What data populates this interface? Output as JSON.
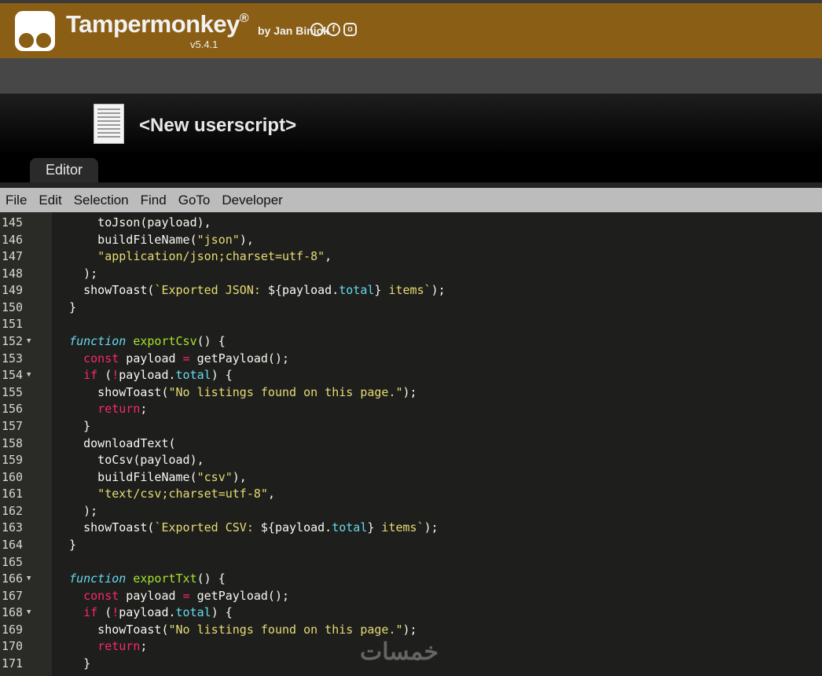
{
  "header": {
    "app_name": "Tampermonkey",
    "registered": "®",
    "byline": "by Jan Biniok",
    "version": "v5.4.1",
    "social_icons": [
      "github-icon",
      "facebook-icon",
      "instagram-icon"
    ],
    "brand_color": "#8a5e14"
  },
  "script": {
    "title": "<New userscript>"
  },
  "tabs": [
    {
      "label": "Editor",
      "active": true
    }
  ],
  "menu": [
    "File",
    "Edit",
    "Selection",
    "Find",
    "GoTo",
    "Developer"
  ],
  "editor": {
    "theme_colors": {
      "string": "#e6db74",
      "keyword": "#f92672",
      "storage": "#66d9ef",
      "function_name": "#a6e22e",
      "property": "#66d9ef",
      "plain": "#f8f8f2"
    },
    "lines": [
      {
        "n": "145",
        "t": [
          [
            "p",
            "      toJson(payload),"
          ]
        ]
      },
      {
        "n": "146",
        "t": [
          [
            "p",
            "      buildFileName("
          ],
          [
            "s",
            "\"json\""
          ],
          [
            "p",
            "),"
          ]
        ]
      },
      {
        "n": "147",
        "t": [
          [
            "p",
            "      "
          ],
          [
            "s",
            "\"application/json;charset=utf-8\""
          ],
          [
            "p",
            ","
          ]
        ]
      },
      {
        "n": "148",
        "t": [
          [
            "p",
            "    );"
          ]
        ]
      },
      {
        "n": "149",
        "t": [
          [
            "p",
            "    showToast("
          ],
          [
            "s",
            "`Exported JSON: "
          ],
          [
            "p",
            "${payload."
          ],
          [
            "c",
            "total"
          ],
          [
            "p",
            "}"
          ],
          [
            "s",
            " items`"
          ],
          [
            "p",
            ");"
          ]
        ]
      },
      {
        "n": "150",
        "t": [
          [
            "p",
            "  }"
          ]
        ]
      },
      {
        "n": "151",
        "t": []
      },
      {
        "n": "152",
        "fold": true,
        "t": [
          [
            "p",
            "  "
          ],
          [
            "f",
            "function"
          ],
          [
            "p",
            " "
          ],
          [
            "n",
            "exportCsv"
          ],
          [
            "p",
            "() {"
          ]
        ]
      },
      {
        "n": "153",
        "t": [
          [
            "p",
            "    "
          ],
          [
            "k",
            "const"
          ],
          [
            "p",
            " payload "
          ],
          [
            "k",
            "="
          ],
          [
            "p",
            " getPayload();"
          ]
        ]
      },
      {
        "n": "154",
        "fold": true,
        "t": [
          [
            "p",
            "    "
          ],
          [
            "k",
            "if"
          ],
          [
            "p",
            " ("
          ],
          [
            "k",
            "!"
          ],
          [
            "p",
            "payload."
          ],
          [
            "c",
            "total"
          ],
          [
            "p",
            ") {"
          ]
        ]
      },
      {
        "n": "155",
        "t": [
          [
            "p",
            "      showToast("
          ],
          [
            "s",
            "\"No listings found on this page.\""
          ],
          [
            "p",
            ");"
          ]
        ]
      },
      {
        "n": "156",
        "t": [
          [
            "p",
            "      "
          ],
          [
            "k",
            "return"
          ],
          [
            "p",
            ";"
          ]
        ]
      },
      {
        "n": "157",
        "t": [
          [
            "p",
            "    }"
          ]
        ]
      },
      {
        "n": "158",
        "t": [
          [
            "p",
            "    downloadText("
          ]
        ]
      },
      {
        "n": "159",
        "t": [
          [
            "p",
            "      toCsv(payload),"
          ]
        ]
      },
      {
        "n": "160",
        "t": [
          [
            "p",
            "      buildFileName("
          ],
          [
            "s",
            "\"csv\""
          ],
          [
            "p",
            "),"
          ]
        ]
      },
      {
        "n": "161",
        "t": [
          [
            "p",
            "      "
          ],
          [
            "s",
            "\"text/csv;charset=utf-8\""
          ],
          [
            "p",
            ","
          ]
        ]
      },
      {
        "n": "162",
        "t": [
          [
            "p",
            "    );"
          ]
        ]
      },
      {
        "n": "163",
        "t": [
          [
            "p",
            "    showToast("
          ],
          [
            "s",
            "`Exported CSV: "
          ],
          [
            "p",
            "${payload."
          ],
          [
            "c",
            "total"
          ],
          [
            "p",
            "}"
          ],
          [
            "s",
            " items`"
          ],
          [
            "p",
            ");"
          ]
        ]
      },
      {
        "n": "164",
        "t": [
          [
            "p",
            "  }"
          ]
        ]
      },
      {
        "n": "165",
        "t": []
      },
      {
        "n": "166",
        "fold": true,
        "t": [
          [
            "p",
            "  "
          ],
          [
            "f",
            "function"
          ],
          [
            "p",
            " "
          ],
          [
            "n",
            "exportTxt"
          ],
          [
            "p",
            "() {"
          ]
        ]
      },
      {
        "n": "167",
        "t": [
          [
            "p",
            "    "
          ],
          [
            "k",
            "const"
          ],
          [
            "p",
            " payload "
          ],
          [
            "k",
            "="
          ],
          [
            "p",
            " getPayload();"
          ]
        ]
      },
      {
        "n": "168",
        "fold": true,
        "t": [
          [
            "p",
            "    "
          ],
          [
            "k",
            "if"
          ],
          [
            "p",
            " ("
          ],
          [
            "k",
            "!"
          ],
          [
            "p",
            "payload."
          ],
          [
            "c",
            "total"
          ],
          [
            "p",
            ") {"
          ]
        ]
      },
      {
        "n": "169",
        "t": [
          [
            "p",
            "      showToast("
          ],
          [
            "s",
            "\"No listings found on this page.\""
          ],
          [
            "p",
            ");"
          ]
        ]
      },
      {
        "n": "170",
        "t": [
          [
            "p",
            "      "
          ],
          [
            "k",
            "return"
          ],
          [
            "p",
            ";"
          ]
        ]
      },
      {
        "n": "171",
        "t": [
          [
            "p",
            "    }"
          ]
        ]
      }
    ]
  },
  "watermark": "خمسات"
}
